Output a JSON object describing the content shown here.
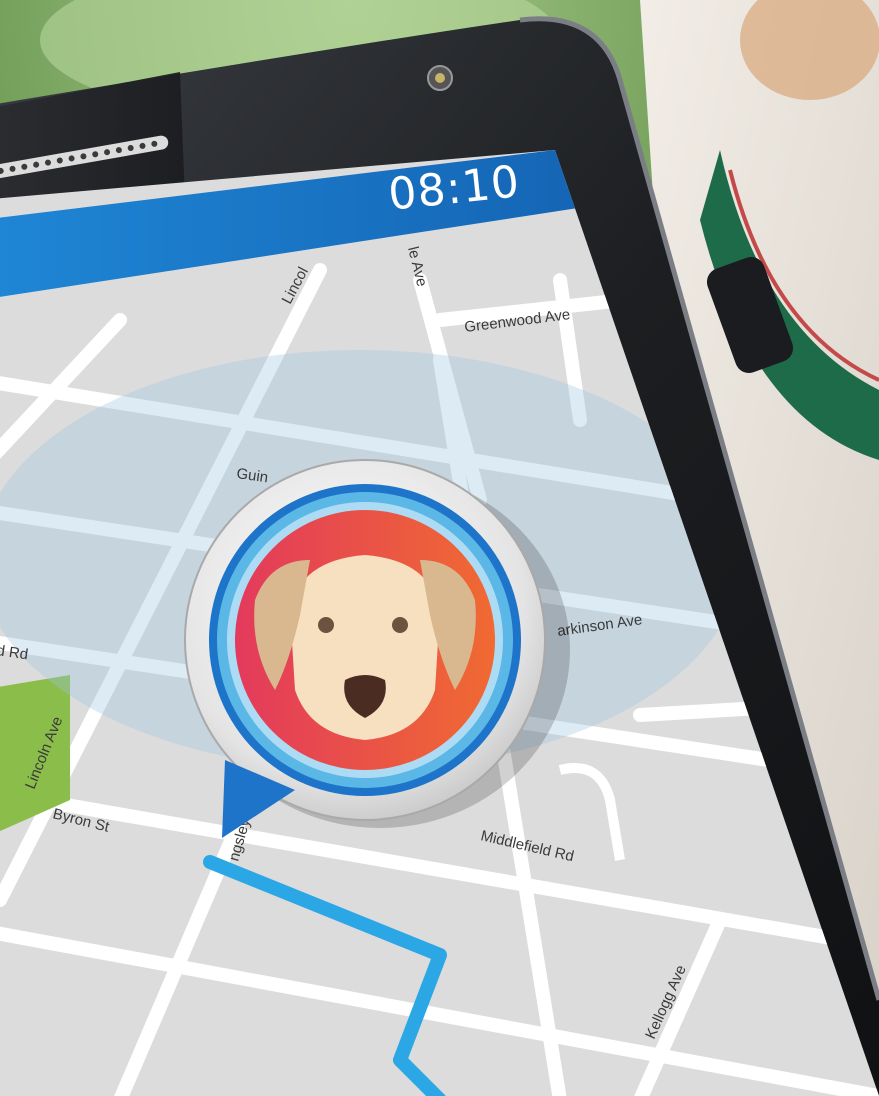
{
  "status_bar": {
    "time": "08:10"
  },
  "map": {
    "streets": [
      "Greenwood Ave",
      "Guin",
      "Lincol",
      "le Ave",
      "arkinson Ave",
      "d Rd",
      "Lincoln Ave",
      "Byron St",
      "ngsley",
      "Middlefield Rd",
      "Kellogg Ave"
    ]
  },
  "pet_marker": {
    "icon": "dog-face-icon",
    "colors": {
      "ring": "#1d74c8",
      "gradient_start": "#e33a5c",
      "gradient_end": "#f06a32"
    }
  },
  "colors": {
    "header_bar": "#1d6fbf",
    "route": "#2aa7e4",
    "park": "#8bbd4a",
    "map_base": "#dcdcdc",
    "road": "#ffffff"
  }
}
